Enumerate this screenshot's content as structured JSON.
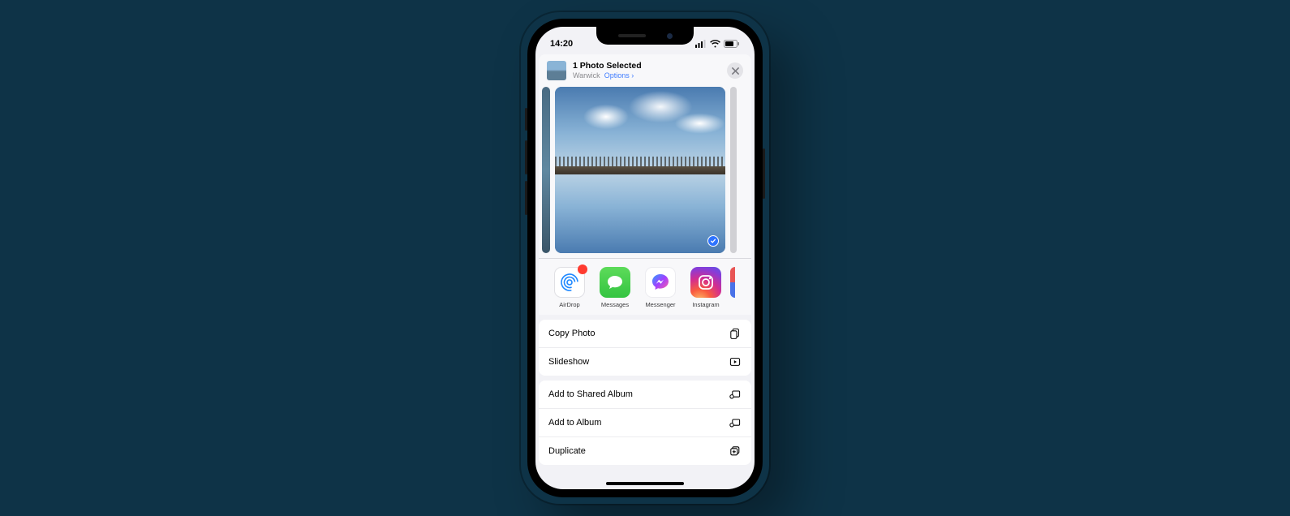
{
  "status": {
    "time": "14:20"
  },
  "sheet": {
    "title": "1 Photo Selected",
    "location": "Warwick",
    "options": "Options"
  },
  "apps": {
    "airdrop": "AirDrop",
    "messages": "Messages",
    "messenger": "Messenger",
    "instagram": "Instagram"
  },
  "actions": {
    "copy": "Copy Photo",
    "slideshow": "Slideshow",
    "addShared": "Add to Shared Album",
    "addAlbum": "Add to Album",
    "duplicate": "Duplicate"
  }
}
